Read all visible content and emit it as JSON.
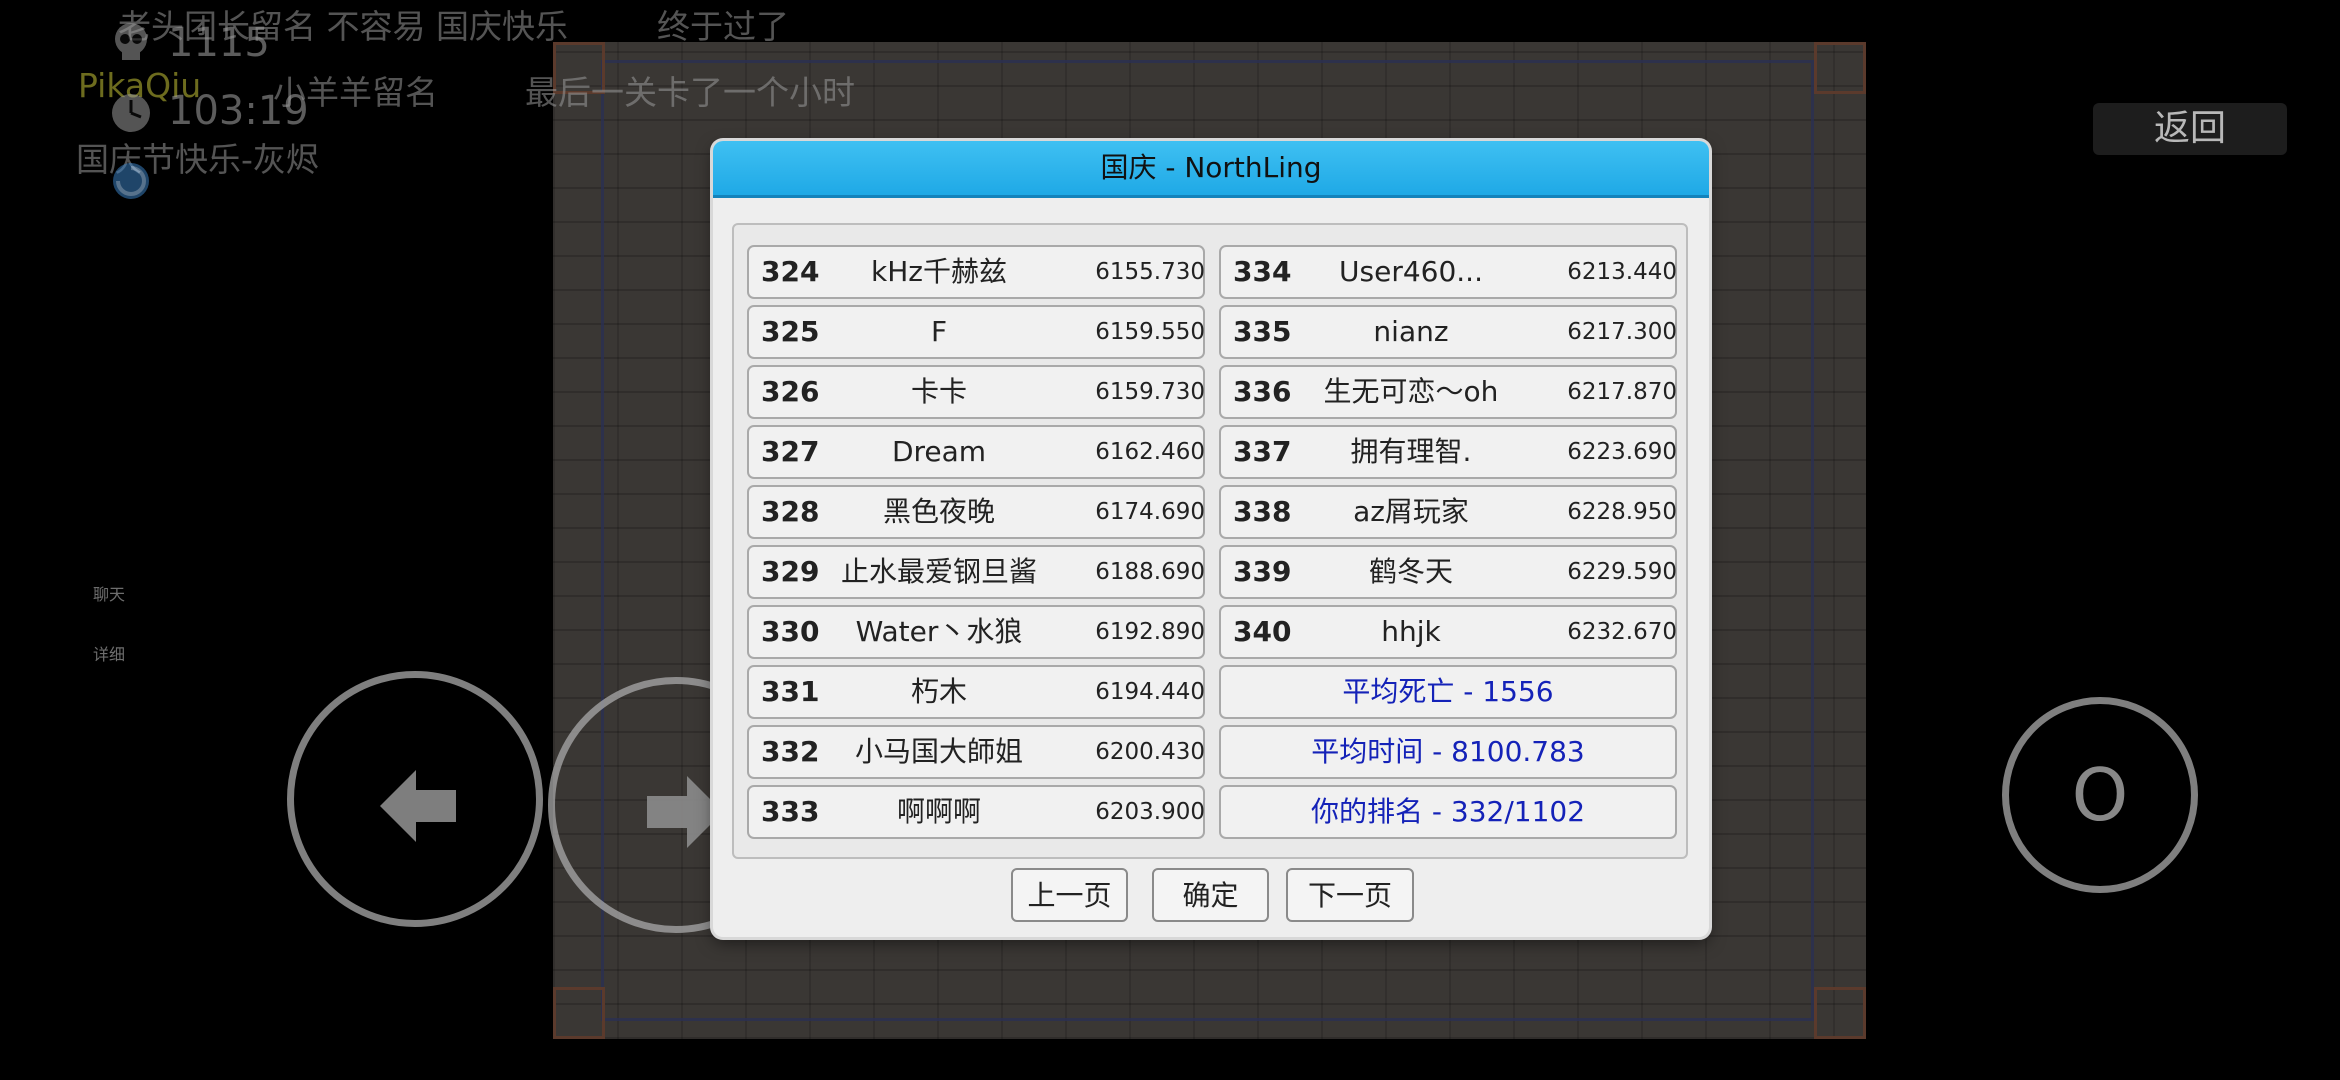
{
  "messages": {
    "line1_a": "老头团长留名 不容易 国庆快乐",
    "line1_b": "终于过了",
    "line2_name": "PikaQiu",
    "line2_a": "小羊羊留名",
    "line2_b": "最后一关卡了一个小时",
    "line3": "国庆节快乐-灰烬"
  },
  "hud": {
    "deaths": "1115",
    "time": "103:19",
    "chat_label": "聊天",
    "detail_label": "详细"
  },
  "back_button": "返回",
  "controls": {
    "left_icon": "left-arrow-icon",
    "right_icon": "right-arrow-icon",
    "action_label": "O"
  },
  "dialog": {
    "title": "国庆 - NorthLing",
    "left_column": [
      {
        "rank": "324",
        "name": "kHz千赫兹",
        "score": "6155.730"
      },
      {
        "rank": "325",
        "name": "F",
        "score": "6159.550"
      },
      {
        "rank": "326",
        "name": "卡卡",
        "score": "6159.730"
      },
      {
        "rank": "327",
        "name": "Dream",
        "score": "6162.460"
      },
      {
        "rank": "328",
        "name": "黑色夜晚",
        "score": "6174.690"
      },
      {
        "rank": "329",
        "name": "止水最爱钢旦酱",
        "score": "6188.690"
      },
      {
        "rank": "330",
        "name": "Water丶水狼",
        "score": "6192.890"
      },
      {
        "rank": "331",
        "name": "朽木",
        "score": "6194.440"
      },
      {
        "rank": "332",
        "name": "小马国大師姐",
        "score": "6200.430"
      },
      {
        "rank": "333",
        "name": "啊啊啊",
        "score": "6203.900"
      }
    ],
    "right_column": [
      {
        "rank": "334",
        "name": "User460...",
        "score": "6213.440"
      },
      {
        "rank": "335",
        "name": "nianz",
        "score": "6217.300"
      },
      {
        "rank": "336",
        "name": "生无可恋～oh",
        "score": "6217.870"
      },
      {
        "rank": "337",
        "name": "拥有理智.",
        "score": "6223.690"
      },
      {
        "rank": "338",
        "name": "az屑玩家",
        "score": "6228.950"
      },
      {
        "rank": "339",
        "name": "鹤冬天",
        "score": "6229.590"
      },
      {
        "rank": "340",
        "name": "hhjk",
        "score": "6232.670"
      }
    ],
    "stats": {
      "avg_deaths": "平均死亡 - 1556",
      "avg_time": "平均时间 - 8100.783",
      "your_rank": "你的排名 - 332/1102"
    },
    "buttons": {
      "prev": "上一页",
      "ok": "确定",
      "next": "下一页"
    }
  },
  "colors": {
    "title_bar": "#1fa9e6",
    "stat_text": "#1422b8"
  }
}
